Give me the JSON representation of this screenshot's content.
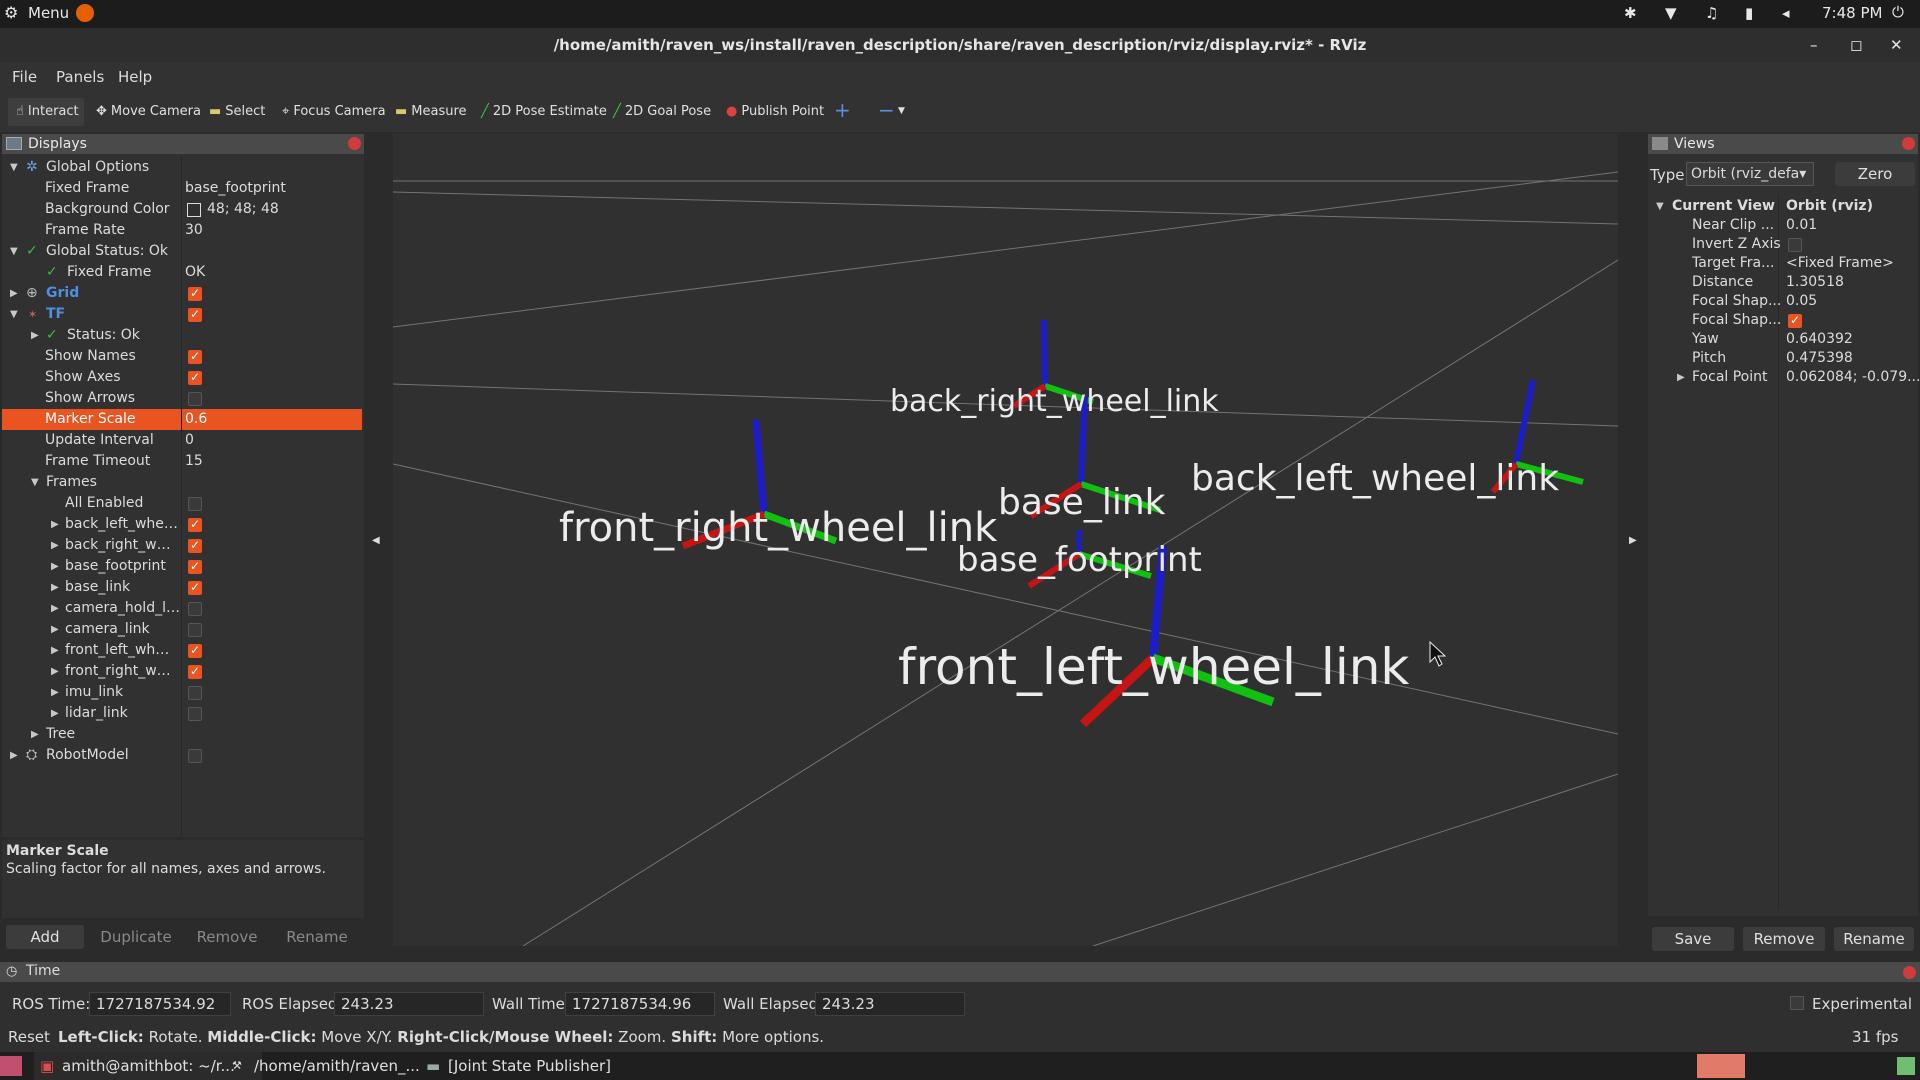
{
  "topbar": {
    "menu": "Menu",
    "time": "7:48 PM"
  },
  "window": {
    "title": "/home/amith/raven_ws/install/raven_description/share/raven_description/rviz/display.rviz* - RViz"
  },
  "menu": {
    "file": "File",
    "panels": "Panels",
    "help": "Help"
  },
  "toolbar": {
    "interact": "Interact",
    "move_camera": "Move Camera",
    "select": "Select",
    "focus_camera": "Focus Camera",
    "measure": "Measure",
    "pose_estimate": "2D Pose Estimate",
    "goal_pose": "2D Goal Pose",
    "publish_point": "Publish Point",
    "plus": "+",
    "minus": "−"
  },
  "displays": {
    "title": "Displays",
    "global_options": "Global Options",
    "fixed_frame_label": "Fixed Frame",
    "fixed_frame_value": "base_footprint",
    "bg_color_label": "Background Color",
    "bg_color_value": "48; 48; 48",
    "frame_rate_label": "Frame Rate",
    "frame_rate_value": "30",
    "global_status": "Global Status: Ok",
    "gs_fixed_frame": "Fixed Frame",
    "gs_fixed_frame_value": "OK",
    "grid": "Grid",
    "tf": "TF",
    "tf_status": "Status: Ok",
    "show_names": "Show Names",
    "show_axes": "Show Axes",
    "show_arrows": "Show Arrows",
    "marker_scale": "Marker Scale",
    "marker_scale_value": "0.6",
    "update_interval": "Update Interval",
    "update_interval_value": "0",
    "frame_timeout": "Frame Timeout",
    "frame_timeout_value": "15",
    "frames": "Frames",
    "all_enabled": "All Enabled",
    "frame_items": [
      "back_left_whe…",
      "back_right_w…",
      "base_footprint",
      "base_link",
      "camera_hold_l…",
      "camera_link",
      "front_left_wh…",
      "front_right_w…",
      "imu_link",
      "lidar_link"
    ],
    "tree": "Tree",
    "robot_model": "RobotModel"
  },
  "description": {
    "title": "Marker Scale",
    "text": "Scaling factor for all names, axes and arrows."
  },
  "display_buttons": {
    "add": "Add",
    "duplicate": "Duplicate",
    "remove": "Remove",
    "rename": "Rename"
  },
  "scene_labels": {
    "back_right": "back_right_wheel_link",
    "base_link": "base_link",
    "back_left": "back_left_wheel_link",
    "front_right": "front_right_wheel_link",
    "base_footprint": "base_footprint",
    "front_left": "front_left_wheel_link"
  },
  "views": {
    "title": "Views",
    "type_label": "Type:",
    "type_value": "Orbit (rviz_defa▾",
    "zero": "Zero",
    "current_view": "Current View",
    "current_view_value": "Orbit (rviz)",
    "near_clip": "Near Clip ...",
    "near_clip_value": "0.01",
    "invert_z": "Invert Z Axis",
    "target_frame": "Target Fra...",
    "target_frame_value": "<Fixed Frame>",
    "distance": "Distance",
    "distance_value": "1.30518",
    "focal_shape1": "Focal Shap...",
    "focal_shape1_value": "0.05",
    "focal_shape2": "Focal Shap...",
    "yaw": "Yaw",
    "yaw_value": "0.640392",
    "pitch": "Pitch",
    "pitch_value": "0.475398",
    "focal_point": "Focal Point",
    "focal_point_value": "0.062084; -0.079...",
    "save": "Save",
    "remove": "Remove",
    "rename": "Rename"
  },
  "time": {
    "title": "Time",
    "ros_time_label": "ROS Time:",
    "ros_time": "1727187534.92",
    "ros_elapsed_label": "ROS Elapsed:",
    "ros_elapsed": "243.23",
    "wall_time_label": "Wall Time:",
    "wall_time": "1727187534.96",
    "wall_elapsed_label": "Wall Elapsed:",
    "wall_elapsed": "243.23",
    "experimental": "Experimental"
  },
  "status": {
    "reset": "Reset",
    "lc": "Left-Click:",
    "lc_t": "Rotate.",
    "mc": "Middle-Click:",
    "mc_t": "Move X/Y.",
    "rc": "Right-Click/Mouse Wheel:",
    "rc_t": "Zoom.",
    "sh": "Shift:",
    "sh_t": "More options.",
    "fps": "31 fps"
  },
  "taskbar": {
    "terminal": "amith@amithbot: ~/r...",
    "rviz": "/home/amith/raven_...",
    "jsp": "[Joint State Publisher]"
  }
}
